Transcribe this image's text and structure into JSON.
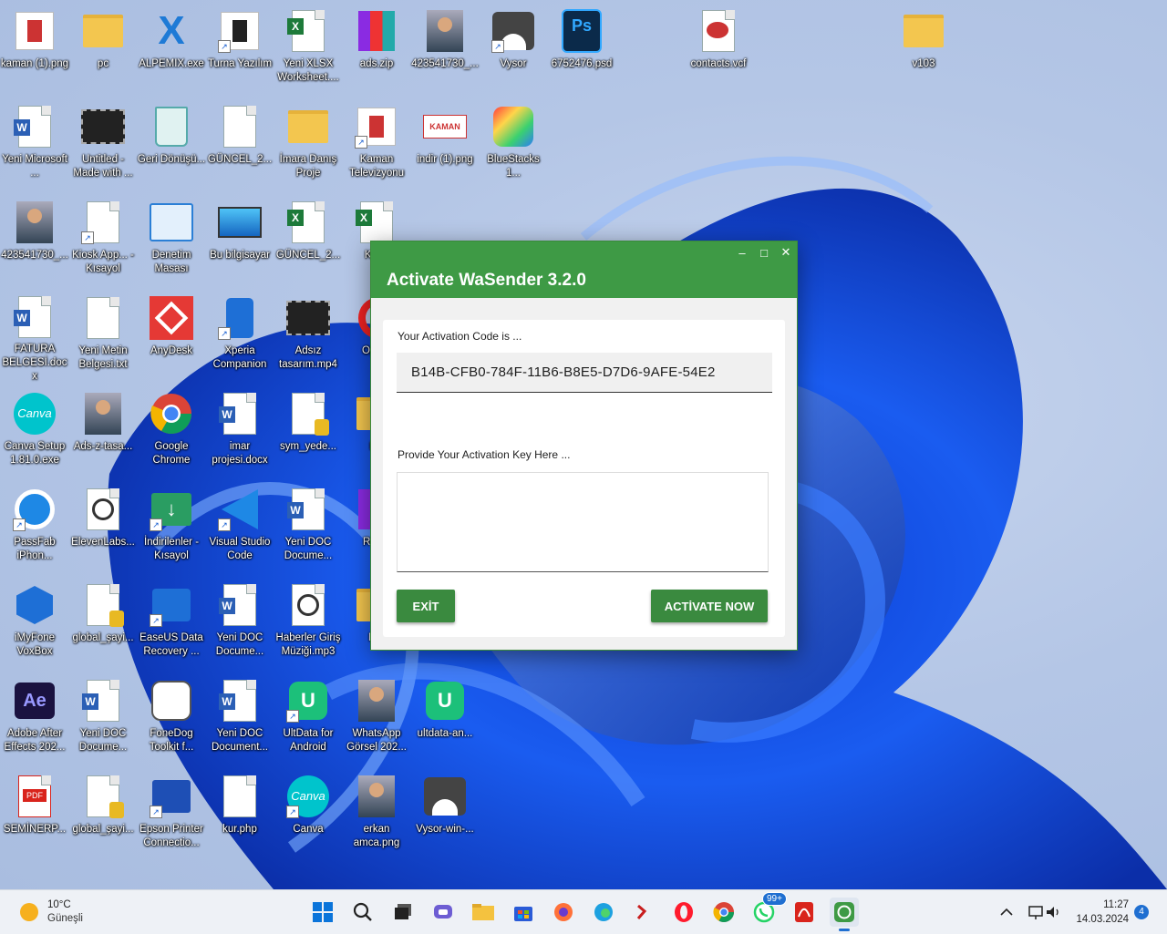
{
  "desktop": {
    "icons": [
      {
        "label": "kaman (1).png"
      },
      {
        "label": "pc"
      },
      {
        "label": "ALPEMIX.exe"
      },
      {
        "label": "Turna Yazılım"
      },
      {
        "label": "Yeni XLSX Worksheet...."
      },
      {
        "label": "ads.zip"
      },
      {
        "label": "423541730_..."
      },
      {
        "label": "Vysor"
      },
      {
        "label": "6752476.psd"
      },
      {
        "label": "contacts.vcf"
      },
      {
        "label": "v103"
      },
      {
        "label": "Yeni Microsoft ..."
      },
      {
        "label": "Untitled - Made with ..."
      },
      {
        "label": "Geri Dönüşü..."
      },
      {
        "label": "GÜNCEL_2..."
      },
      {
        "label": "İmara Danış Proje"
      },
      {
        "label": "Kaman Televizyonu"
      },
      {
        "label": "indir (1).png"
      },
      {
        "label": "BlueStacks 1..."
      },
      {
        "label": "423541730_..."
      },
      {
        "label": "Kiosk App... - Kısayol"
      },
      {
        "label": "Denetim Masası"
      },
      {
        "label": "Bu bilgisayar"
      },
      {
        "label": "GÜNCEL_2..."
      },
      {
        "label": "Kitap"
      },
      {
        "label": "FATURA BELGESİ.docx"
      },
      {
        "label": "Yeni Metin Belgesi.txt"
      },
      {
        "label": "AnyDesk"
      },
      {
        "label": "Xperia Companion"
      },
      {
        "label": "Adsız tasarım.mp4"
      },
      {
        "label": "Op tar"
      },
      {
        "label": "Canva Setup 1.81.0.exe"
      },
      {
        "label": "Ads-z-tasa..."
      },
      {
        "label": "Google Chrome"
      },
      {
        "label": "imar projesi.docx"
      },
      {
        "label": "sym_yede..."
      },
      {
        "label": "HA"
      },
      {
        "label": "PassFab iPhon..."
      },
      {
        "label": "ElevenLabs..."
      },
      {
        "label": "İndirilenler - Kısayol"
      },
      {
        "label": "Visual Studio Code"
      },
      {
        "label": "Yeni DOC Docume..."
      },
      {
        "label": "Repai"
      },
      {
        "label": "iMyFone VoxBox"
      },
      {
        "label": "global_şayi..."
      },
      {
        "label": "EaseUS Data Recovery ..."
      },
      {
        "label": "Yeni DOC Docume..."
      },
      {
        "label": "Haberler Giriş Müziği.mp3"
      },
      {
        "label": "MU"
      },
      {
        "label": "Adobe After Effects 202..."
      },
      {
        "label": "Yeni DOC Docume..."
      },
      {
        "label": "FoneDog Toolkit f..."
      },
      {
        "label": "Yeni DOC Document..."
      },
      {
        "label": "UltData for Android"
      },
      {
        "label": "WhatsApp Görsel 202..."
      },
      {
        "label": "ultdata-an..."
      },
      {
        "label": "SEMİNERP..."
      },
      {
        "label": "global_şayi..."
      },
      {
        "label": "Epson Printer Connectio..."
      },
      {
        "label": "kur.php"
      },
      {
        "label": "Canva"
      },
      {
        "label": "erkan amca.png"
      },
      {
        "label": "Vysor-win-..."
      }
    ]
  },
  "dialog": {
    "title": "Activate WaSender 3.2.0",
    "activation_code_label": "Your Activation Code is ...",
    "activation_code": "B14B-CFB0-784F-11B6-B8E5-D7D6-9AFE-54E2",
    "activation_key_label": "Provide Your Activation Key Here ...",
    "activation_key_value": "",
    "exit_label": "EXİT",
    "activate_label": "ACTİVATE NOW",
    "min_glyph": "–",
    "max_glyph": "□",
    "close_glyph": "✕"
  },
  "taskbar": {
    "weather_temp": "10°C",
    "weather_desc": "Güneşli",
    "whatsapp_badge": "99+",
    "time": "11:27",
    "date": "14.03.2024",
    "notification_count": "4",
    "colors": {
      "accent": "#3e9a45"
    }
  }
}
